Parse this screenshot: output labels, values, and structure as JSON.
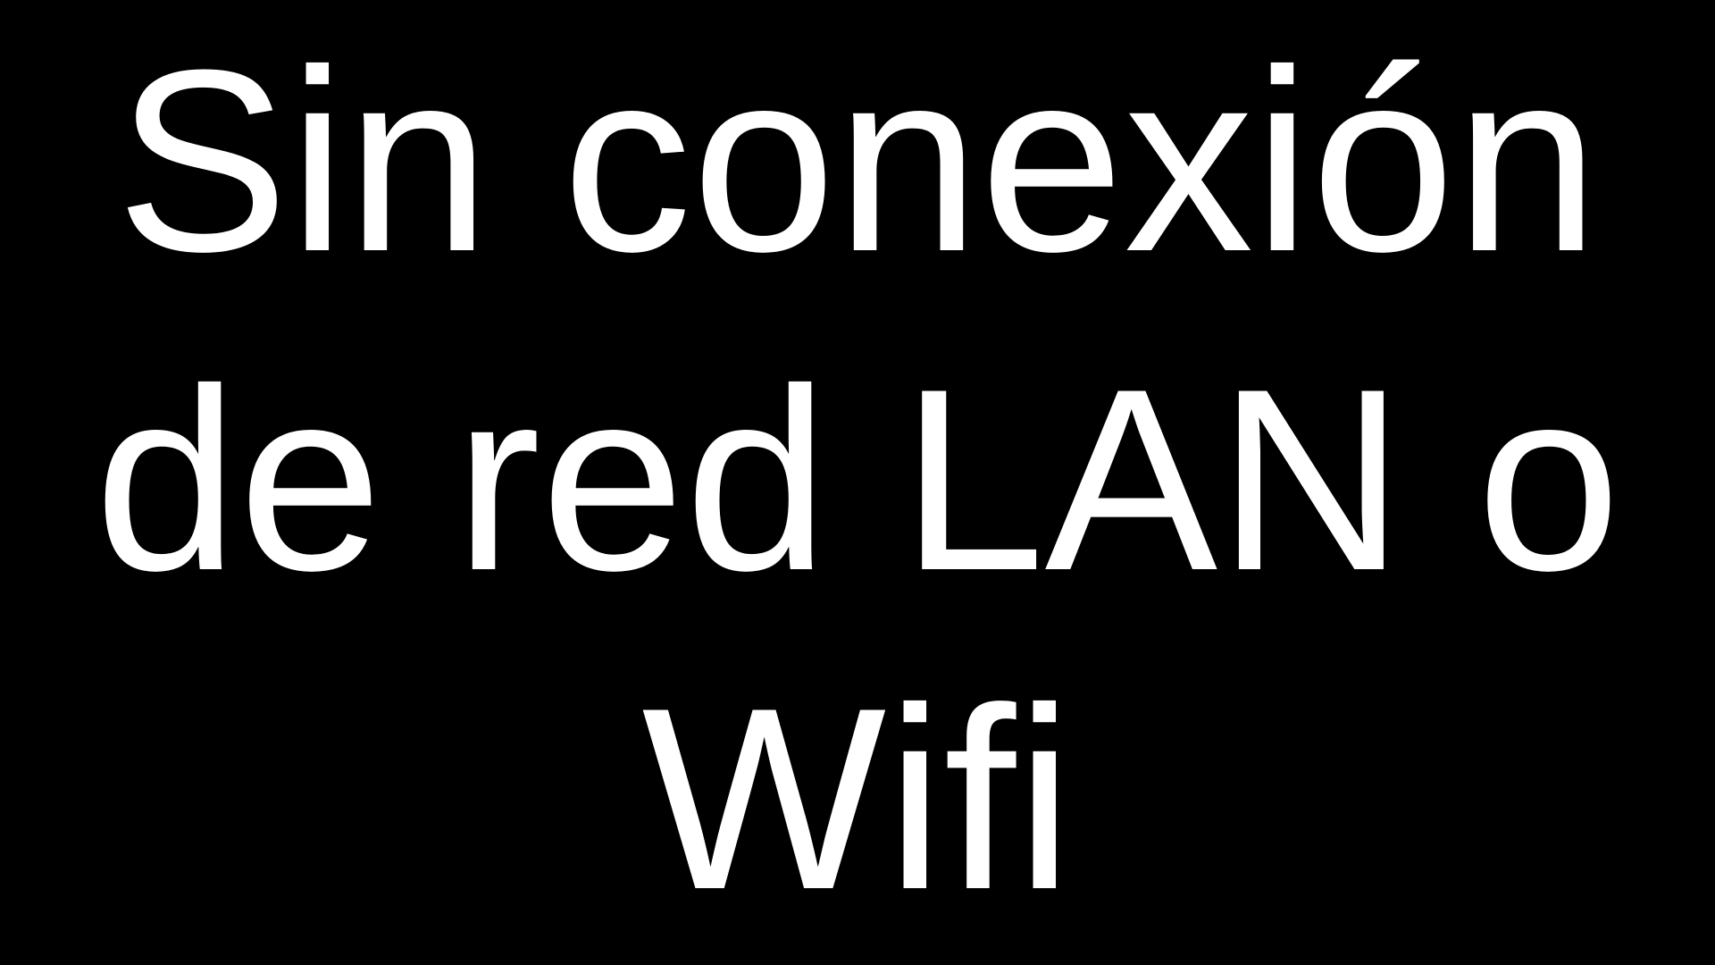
{
  "screen": {
    "background_color": "#000000",
    "text_color": "#ffffff",
    "message_lines": [
      "Sin conexión",
      "de red LAN o",
      "Wifi"
    ]
  }
}
